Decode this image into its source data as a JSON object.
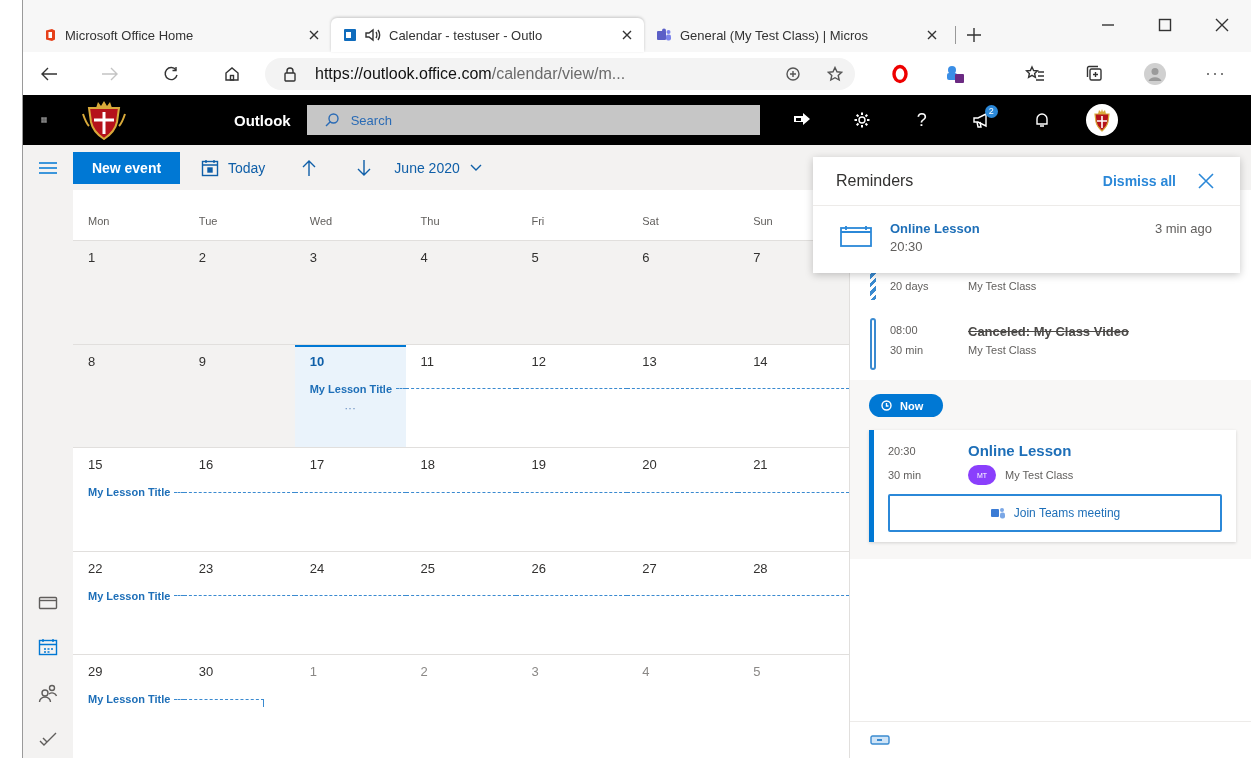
{
  "browser": {
    "tabs": [
      {
        "title": "Microsoft Office Home",
        "selected": false,
        "kind": "office",
        "audio": false
      },
      {
        "title": "Calendar - testuser - Outlo",
        "selected": true,
        "kind": "outlook",
        "audio": true
      },
      {
        "title": "General (My Test Class) | Micros",
        "selected": false,
        "kind": "teams",
        "audio": false
      }
    ],
    "forward_disabled": true,
    "address": {
      "host": "https://outlook.office.com",
      "path": "/calendar/view/m..."
    }
  },
  "header": {
    "app_name": "Outlook",
    "search": {
      "placeholder": "Search"
    },
    "help": "?",
    "notification_badge": "2"
  },
  "toolbar": {
    "new_event": "New event",
    "today": "Today",
    "month": "June 2020"
  },
  "rail": [
    {
      "kind": "mail",
      "selected": false
    },
    {
      "kind": "calendar",
      "selected": true
    },
    {
      "kind": "people",
      "selected": false
    },
    {
      "kind": "todo",
      "selected": false
    }
  ],
  "calendar": {
    "weekdays": [
      "Mon",
      "Tue",
      "Wed",
      "Thu",
      "Fri",
      "Sat",
      "Sun"
    ],
    "weeks": [
      {
        "days": [
          {
            "number": "1",
            "past": true,
            "selected": false,
            "outside_month": false,
            "kind": "empty"
          },
          {
            "number": "2",
            "past": true,
            "selected": false,
            "outside_month": false,
            "kind": "empty"
          },
          {
            "number": "3",
            "past": true,
            "selected": false,
            "outside_month": false,
            "kind": "empty"
          },
          {
            "number": "4",
            "past": true,
            "selected": false,
            "outside_month": false,
            "kind": "empty"
          },
          {
            "number": "5",
            "past": true,
            "selected": false,
            "outside_month": false,
            "kind": "empty"
          },
          {
            "number": "6",
            "past": true,
            "selected": false,
            "outside_month": false,
            "kind": "empty"
          },
          {
            "number": "7",
            "past": true,
            "selected": false,
            "outside_month": false,
            "kind": "empty"
          }
        ]
      },
      {
        "days": [
          {
            "number": "8",
            "past": true,
            "selected": false,
            "outside_month": false,
            "kind": "empty"
          },
          {
            "number": "9",
            "past": true,
            "selected": false,
            "outside_month": false,
            "kind": "empty"
          },
          {
            "number": "10",
            "past": false,
            "selected": true,
            "outside_month": false,
            "kind": "span",
            "event_title": "My Lesson Title",
            "more": "···"
          },
          {
            "number": "11",
            "past": false,
            "selected": false,
            "outside_month": false,
            "kind": "span"
          },
          {
            "number": "12",
            "past": false,
            "selected": false,
            "outside_month": false,
            "kind": "span"
          },
          {
            "number": "13",
            "past": false,
            "selected": false,
            "outside_month": false,
            "kind": "span"
          },
          {
            "number": "14",
            "past": false,
            "selected": false,
            "outside_month": false,
            "kind": "span"
          }
        ]
      },
      {
        "days": [
          {
            "number": "15",
            "past": false,
            "selected": false,
            "outside_month": false,
            "kind": "span",
            "event_title": "My Lesson Title"
          },
          {
            "number": "16",
            "past": false,
            "selected": false,
            "outside_month": false,
            "kind": "span"
          },
          {
            "number": "17",
            "past": false,
            "selected": false,
            "outside_month": false,
            "kind": "span"
          },
          {
            "number": "18",
            "past": false,
            "selected": false,
            "outside_month": false,
            "kind": "span"
          },
          {
            "number": "19",
            "past": false,
            "selected": false,
            "outside_month": false,
            "kind": "span"
          },
          {
            "number": "20",
            "past": false,
            "selected": false,
            "outside_month": false,
            "kind": "span"
          },
          {
            "number": "21",
            "past": false,
            "selected": false,
            "outside_month": false,
            "kind": "span"
          }
        ]
      },
      {
        "days": [
          {
            "number": "22",
            "past": false,
            "selected": false,
            "outside_month": false,
            "kind": "span",
            "event_title": "My Lesson Title"
          },
          {
            "number": "23",
            "past": false,
            "selected": false,
            "outside_month": false,
            "kind": "span"
          },
          {
            "number": "24",
            "past": false,
            "selected": false,
            "outside_month": false,
            "kind": "span"
          },
          {
            "number": "25",
            "past": false,
            "selected": false,
            "outside_month": false,
            "kind": "span"
          },
          {
            "number": "26",
            "past": false,
            "selected": false,
            "outside_month": false,
            "kind": "span"
          },
          {
            "number": "27",
            "past": false,
            "selected": false,
            "outside_month": false,
            "kind": "span"
          },
          {
            "number": "28",
            "past": false,
            "selected": false,
            "outside_month": false,
            "kind": "span"
          }
        ]
      },
      {
        "days": [
          {
            "number": "29",
            "past": false,
            "selected": false,
            "outside_month": false,
            "kind": "span",
            "event_title": "My Lesson Title"
          },
          {
            "number": "30",
            "past": false,
            "selected": false,
            "outside_month": false,
            "kind": "span_end"
          },
          {
            "number": "1",
            "past": false,
            "selected": false,
            "outside_month": true,
            "kind": "empty"
          },
          {
            "number": "2",
            "past": false,
            "selected": false,
            "outside_month": true,
            "kind": "empty"
          },
          {
            "number": "3",
            "past": false,
            "selected": false,
            "outside_month": true,
            "kind": "empty"
          },
          {
            "number": "4",
            "past": false,
            "selected": false,
            "outside_month": true,
            "kind": "empty"
          },
          {
            "number": "5",
            "past": false,
            "selected": false,
            "outside_month": true,
            "kind": "empty"
          }
        ]
      }
    ]
  },
  "agenda": {
    "items": [
      {
        "kind": "multiday",
        "duration": "20 days",
        "subtitle": "My Test Class"
      },
      {
        "kind": "outline",
        "time": "08:00",
        "duration": "30 min",
        "title": "Canceled: My Class Video",
        "subtitle": "My Test Class",
        "canceled": true
      }
    ],
    "now": "Now",
    "current": {
      "time": "20:30",
      "duration": "30 min",
      "title": "Online Lesson",
      "avatar": "MT",
      "group": "My Test Class",
      "join": "Join Teams meeting"
    }
  },
  "reminders": {
    "title": "Reminders",
    "dismiss_all": "Dismiss all",
    "items": [
      {
        "title": "Online Lesson",
        "time": "20:30",
        "ago": "3 min ago"
      }
    ]
  }
}
